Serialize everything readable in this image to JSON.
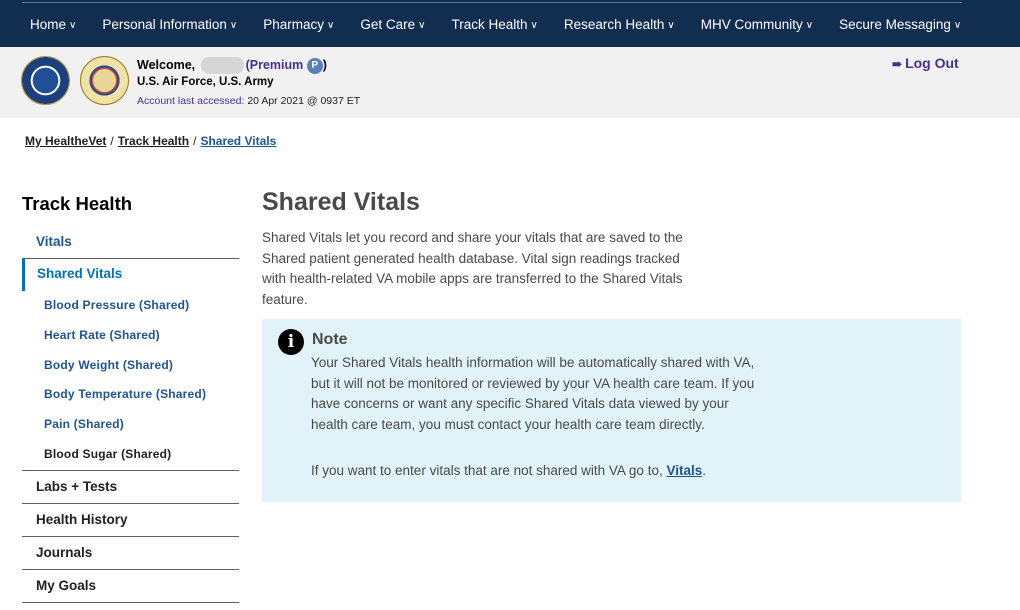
{
  "topnav": {
    "items": [
      {
        "label": "Home"
      },
      {
        "label": "Personal Information"
      },
      {
        "label": "Pharmacy"
      },
      {
        "label": "Get Care"
      },
      {
        "label": "Track Health"
      },
      {
        "label": "Research Health"
      },
      {
        "label": "MHV Community"
      },
      {
        "label": "Secure Messaging"
      }
    ],
    "chevron_icon": "chevron-down-icon"
  },
  "account": {
    "welcome": "Welcome,",
    "premium_label": "(Premium",
    "premium_badge": "P",
    "premium_close": ")",
    "branches": "U.S. Air Force, U.S. Army",
    "last_accessed_label": "Account last accessed:",
    "last_accessed_value": "20 Apr 2021 @ 0937 ET",
    "logout_label": "Log Out",
    "seals": [
      "air-force-seal",
      "army-seal"
    ]
  },
  "breadcrumb": {
    "items": [
      {
        "label": "My HealtheVet"
      },
      {
        "label": "Track Health"
      },
      {
        "label": "Shared Vitals"
      }
    ],
    "separator": "/"
  },
  "sidebar": {
    "title": "Track Health",
    "vitals": "Vitals",
    "shared_vitals": "Shared Vitals",
    "sub_items": [
      {
        "label": "Blood Pressure (Shared)"
      },
      {
        "label": "Heart Rate (Shared)"
      },
      {
        "label": "Body Weight (Shared)"
      },
      {
        "label": "Body Temperature (Shared)"
      },
      {
        "label": "Pain (Shared)"
      },
      {
        "label": "Blood Sugar (Shared)"
      }
    ],
    "other_items": [
      {
        "label": "Labs + Tests"
      },
      {
        "label": "Health History"
      },
      {
        "label": "Journals"
      },
      {
        "label": "My Goals"
      }
    ]
  },
  "main": {
    "title": "Shared Vitals",
    "intro": "Shared Vitals let you record and share your vitals that are saved to the Shared patient generated health database. Vital sign readings tracked with health-related VA mobile apps are transferred to the Shared Vitals feature.",
    "note": {
      "icon": "info-icon",
      "title": "Note",
      "body": "Your Shared Vitals health information will be automatically shared with VA, but it will not be monitored or reviewed by your VA health care team. If you have concerns or want any specific Shared Vitals data viewed by your health care team, you must contact your health care team directly.",
      "link_prefix": "If you want to enter vitals that are not shared with VA go to,",
      "link_label": "Vitals",
      "link_suffix": "."
    }
  },
  "colors": {
    "nav_bg": "#112e51",
    "account_bg": "#f1f1f1",
    "premium": "#4a2f8f",
    "link": "#205493",
    "active": "#0071bb",
    "note_bg": "#e1f3f8"
  }
}
